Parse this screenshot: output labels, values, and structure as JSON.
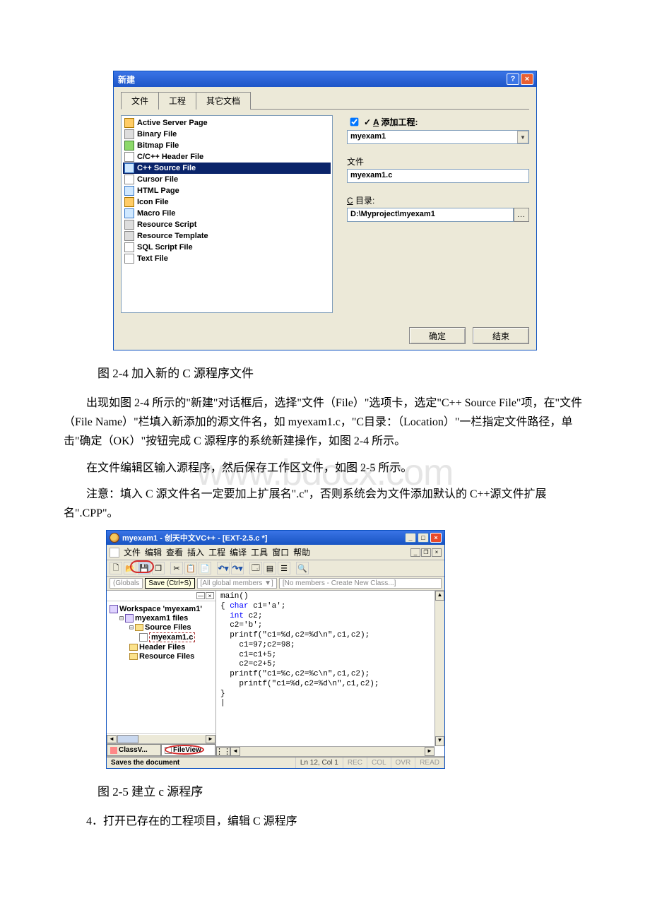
{
  "dialog": {
    "title": "新建",
    "tabs": [
      "文件",
      "工程",
      "其它文档"
    ],
    "file_types": [
      {
        "icon": "ic-asp",
        "label": "Active Server Page"
      },
      {
        "icon": "ic-bin",
        "label": "Binary File"
      },
      {
        "icon": "ic-bmp",
        "label": "Bitmap File"
      },
      {
        "icon": "ic-h",
        "label": "C/C++ Header File"
      },
      {
        "icon": "ic-cpp",
        "label": "C++ Source File",
        "selected": true
      },
      {
        "icon": "ic-cur",
        "label": "Cursor File"
      },
      {
        "icon": "ic-htm",
        "label": "HTML Page"
      },
      {
        "icon": "ic-ico",
        "label": "Icon File"
      },
      {
        "icon": "ic-mac",
        "label": "Macro File"
      },
      {
        "icon": "ic-res",
        "label": "Resource Script"
      },
      {
        "icon": "ic-tpl",
        "label": "Resource Template"
      },
      {
        "icon": "ic-sql",
        "label": "SQL Script File"
      },
      {
        "icon": "ic-txt",
        "label": "Text File"
      }
    ],
    "add_project_label": "A 添加工程:",
    "project_value": "myexam1",
    "filename_label": "文件",
    "filename_value": "myexam1.c",
    "dir_label": "C 目录:",
    "dir_value": "D:\\Myproject\\myexam1",
    "ok": "确定",
    "cancel": "结束"
  },
  "captions": {
    "fig24": "图 2-4 加入新的 C 源程序文件",
    "fig25": "图 2-5 建立 c 源程序"
  },
  "paras": {
    "p1": "出现如图 2-4 所示的\"新建\"对话框后，选择\"文件（File）\"选项卡，选定\"C++ Source File\"项，在\"文件（File Name）\"栏填入新添加的源文件名，如 myexam1.c，\"C目录：（Location）\"一栏指定文件路径，单击\"确定（OK）\"按钮完成 C 源程序的系统新建操作，如图 2-4 所示。",
    "p2": "在文件编辑区输入源程序，然后保存工作区文件，如图 2-5 所示。",
    "p3": "注意：填入 C 源文件名一定要加上扩展名\".c\"，否则系统会为文件添加默认的 C++源文件扩展名\".CPP\"。",
    "p4": "4．打开已存在的工程项目，编辑 C 源程序"
  },
  "watermark": "www.bdocx.com",
  "ide": {
    "title": "myexam1 - 创天中文VC++ - [EXT-2.5.c *]",
    "menu": [
      "文件",
      "编辑",
      "查看",
      "插入",
      "工程",
      "编译",
      "工具",
      "窗口",
      "帮助"
    ],
    "tooltip": "Save (Ctrl+S)",
    "tb2_globals": "[Globals]",
    "tb2_all": "[All global members ▼]",
    "tb2_nomem": "[No members - Create New Class...]",
    "tree": {
      "workspace": "Workspace 'myexam1'",
      "project": "myexam1 files",
      "source_folder": "Source Files",
      "selected_file": "myexam1.c",
      "header_folder": "Header Files",
      "resource_folder": "Resource Files",
      "tabs": {
        "class": "ClassV...",
        "file": "FileView"
      }
    },
    "code": {
      "l1": "main()",
      "l2": "{ ",
      "l2_kw": "char",
      "l2_rest": " c1='a';",
      "l3_sp": "  ",
      "l3_kw": "int",
      "l3_rest": " c2;",
      "l4": "  c2='b';",
      "l5": "  printf(\"c1=%d,c2=%d\\n\",c1,c2);",
      "l6": "    c1=97;c2=98;",
      "l7": "    c1=c1+5;",
      "l8": "    c2=c2+5;",
      "l9": "  printf(\"c1=%c,c2=%c\\n\",c1,c2);",
      "l10": "    printf(\"c1=%d,c2=%d\\n\",c1,c2);",
      "l11": "}",
      "l12": "|"
    },
    "status": {
      "msg": "Saves the document",
      "pos": "Ln 12, Col 1",
      "rec": "REC",
      "col": "COL",
      "ovr": "OVR",
      "read": "READ"
    }
  }
}
